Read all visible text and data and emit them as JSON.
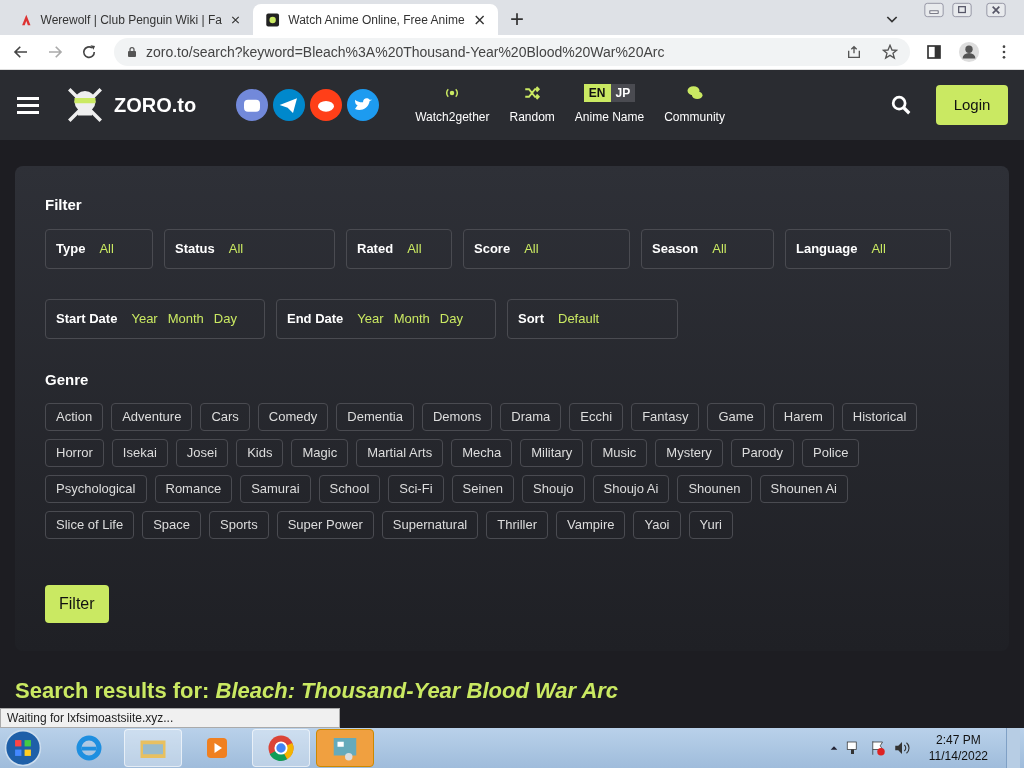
{
  "browser": {
    "tabs": [
      {
        "title": "Werewolf | Club Penguin Wiki | Fa",
        "selected": false
      },
      {
        "title": "Watch Anime Online, Free Anime",
        "selected": true
      }
    ],
    "new_tab": "+",
    "address": "zoro.to/search?keyword=Bleach%3A%20Thousand-Year%20Blood%20War%20Arc"
  },
  "header": {
    "logo": "ZORO.to",
    "nav": [
      {
        "kind": "broadcast",
        "label": "Watch2gether"
      },
      {
        "kind": "shuffle",
        "label": "Random"
      },
      {
        "kind": "lang",
        "label": "Anime Name"
      },
      {
        "kind": "chat",
        "label": "Community"
      }
    ],
    "lang_toggle": [
      {
        "label": "EN",
        "selected": true
      },
      {
        "label": "JP",
        "selected": false
      }
    ],
    "login": "Login"
  },
  "filter": {
    "title": "Filter",
    "selects": [
      {
        "label": "Type",
        "values": [
          "All"
        ]
      },
      {
        "label": "Status",
        "values": [
          "All"
        ]
      },
      {
        "label": "Rated",
        "values": [
          "All"
        ]
      },
      {
        "label": "Score",
        "values": [
          "All"
        ]
      },
      {
        "label": "Season",
        "values": [
          "All"
        ]
      },
      {
        "label": "Language",
        "values": [
          "All"
        ]
      }
    ],
    "selects2": [
      {
        "label": "Start Date",
        "values": [
          "Year",
          "Month",
          "Day"
        ]
      },
      {
        "label": "End Date",
        "values": [
          "Year",
          "Month",
          "Day"
        ]
      },
      {
        "label": "Sort",
        "values": [
          "Default"
        ]
      }
    ],
    "genre_title": "Genre",
    "genres": [
      "Action",
      "Adventure",
      "Cars",
      "Comedy",
      "Dementia",
      "Demons",
      "Drama",
      "Ecchi",
      "Fantasy",
      "Game",
      "Harem",
      "Historical",
      "Horror",
      "Isekai",
      "Josei",
      "Kids",
      "Magic",
      "Martial Arts",
      "Mecha",
      "Military",
      "Music",
      "Mystery",
      "Parody",
      "Police",
      "Psychological",
      "Romance",
      "Samurai",
      "School",
      "Sci-Fi",
      "Seinen",
      "Shoujo",
      "Shoujo Ai",
      "Shounen",
      "Shounen Ai",
      "Slice of Life",
      "Space",
      "Sports",
      "Super Power",
      "Supernatural",
      "Thriller",
      "Vampire",
      "Yaoi",
      "Yuri"
    ],
    "button": "Filter"
  },
  "results_heading": {
    "prefix": "Search results for:",
    "query": "Bleach: Thousand-Year Blood War Arc"
  },
  "status_bubble": "Waiting for lxfsimoastsiite.xyz...",
  "taskbar": {
    "time": "2:47 PM",
    "date": "11/14/2022"
  }
}
